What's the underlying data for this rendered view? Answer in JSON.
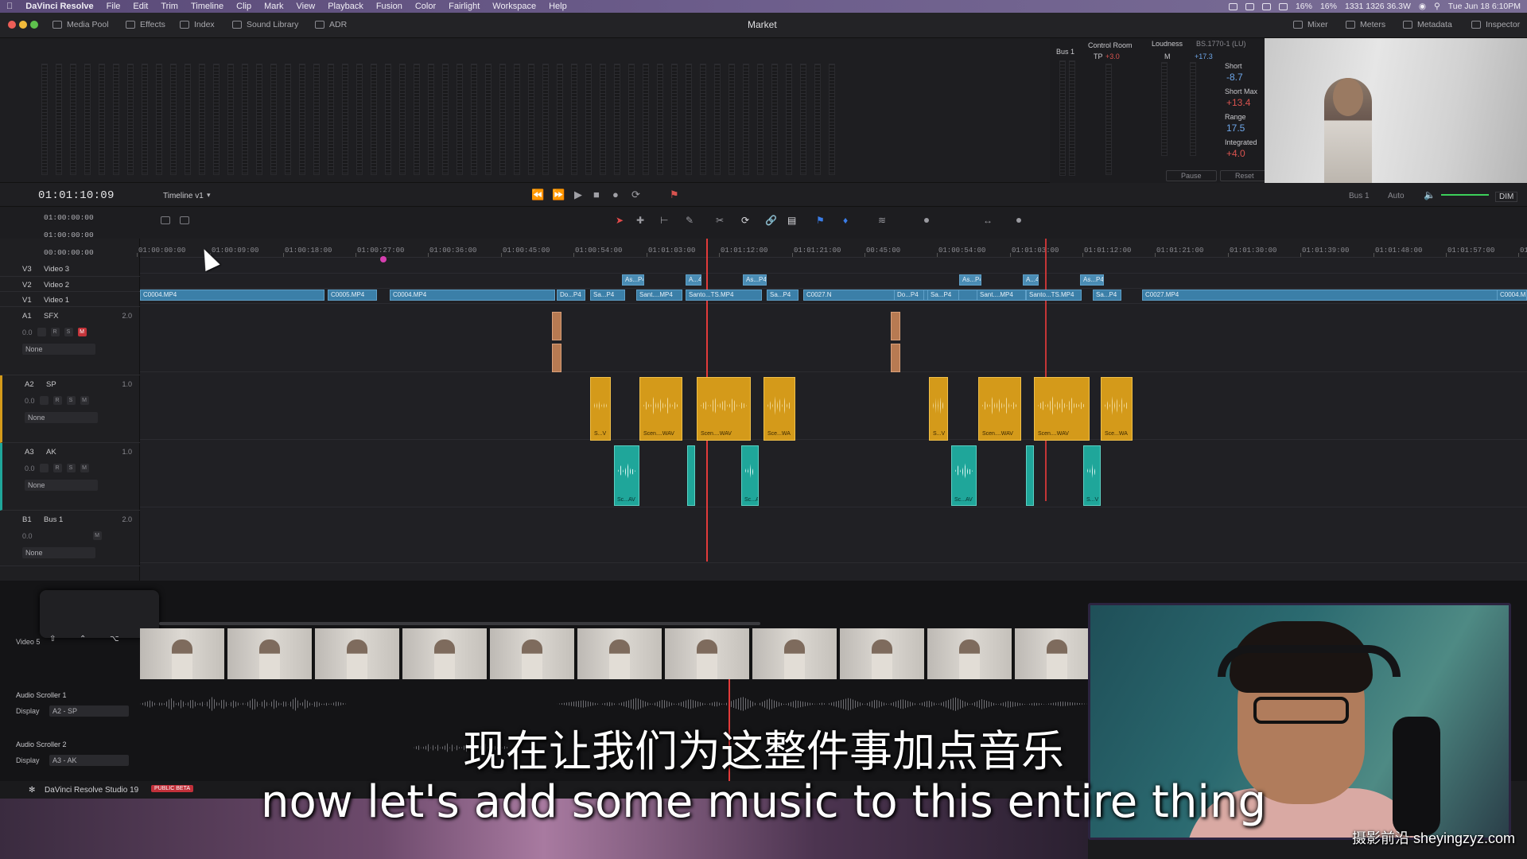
{
  "menubar": {
    "app": "DaVinci Resolve",
    "items": [
      "File",
      "Edit",
      "Trim",
      "Timeline",
      "Clip",
      "Mark",
      "View",
      "Playback",
      "Fusion",
      "Color",
      "Fairlight",
      "Workspace",
      "Help"
    ],
    "status": {
      "cpu1": "16%",
      "cpu2": "16%",
      "net": "1331 1326 36.3W",
      "datetime": "Tue Jun 18 6:10PM"
    }
  },
  "toolbar": {
    "media_pool": "Media Pool",
    "effects": "Effects",
    "index": "Index",
    "sound_library": "Sound Library",
    "adr": "ADR",
    "title": "Market",
    "mixer": "Mixer",
    "meters": "Meters",
    "metadata": "Metadata",
    "inspector": "Inspector"
  },
  "monitor": {
    "bus": "Bus 1",
    "control_room": "Control Room",
    "tp_label": "TP",
    "tp_value": "+3.0",
    "loudness": "Loudness",
    "standard": "BS.1770-1 (LU)",
    "m_label": "M",
    "m_value": "+17.3",
    "short_label": "Short",
    "short_value": "-8.7",
    "short_max_label": "Short Max",
    "short_max_value": "+13.4",
    "range_label": "Range",
    "range_value": "17.5",
    "integrated_label": "Integrated",
    "integrated_value": "+4.0",
    "pause": "Pause",
    "reset": "Reset"
  },
  "transport": {
    "timecode": "01:01:10:09",
    "timeline": "Timeline v1",
    "bus": "Bus 1",
    "auto": "Auto",
    "dim": "DIM"
  },
  "timecodes": {
    "in": "01:00:00:00",
    "out": "01:00:00:00",
    "duration": "00:00:00:00"
  },
  "ruler": [
    "01:00:00:00",
    "01:00:09:00",
    "01:00:18:00",
    "01:00:27:00",
    "01:00:36:00",
    "01:00:45:00",
    "01:00:54:00",
    "01:01:03:00",
    "01:01:12:00",
    "01:01:21:00",
    "00:45:00",
    "01:00:54:00",
    "01:01:03:00",
    "01:01:12:00",
    "01:01:21:00",
    "01:01:30:00",
    "01:01:39:00",
    "01:01:48:00",
    "01:01:57:00",
    "01:02:06:0"
  ],
  "tracks": {
    "v3": {
      "id": "V3",
      "name": "Video 3"
    },
    "v2": {
      "id": "V2",
      "name": "Video 2"
    },
    "v1": {
      "id": "V1",
      "name": "Video 1"
    },
    "a1": {
      "id": "A1",
      "name": "SFX",
      "vol": "2.0",
      "level": "0.0",
      "input": "None"
    },
    "a2": {
      "id": "A2",
      "name": "SP",
      "vol": "1.0",
      "level": "0.0",
      "input": "None"
    },
    "a3": {
      "id": "A3",
      "name": "AK",
      "vol": "1.0",
      "level": "0.0",
      "input": "None"
    },
    "b1": {
      "id": "B1",
      "name": "Bus 1",
      "vol": "2.0",
      "level": "0.0",
      "input": "None"
    }
  },
  "v1_clips": [
    "C0004.MP4",
    "C0005.MP4",
    "C0004.MP4",
    "Do...P4",
    "Sa...P4",
    "Sant....MP4",
    "Santo...TS.MP4",
    "Sa...P4",
    "C0027.N",
    "Do...P4",
    "Sa...P4",
    "Sant....MP4",
    "Santo...TS.MP4",
    "Sa...P4",
    "C0027.MP4",
    "C0004.M"
  ],
  "v2_clips": [
    "As...P4",
    "A...4",
    "As...P4",
    "As...P4",
    "A...4",
    "As...P4"
  ],
  "a2_clips": [
    "S...V",
    "Scen....WAV",
    "Scen....WAV",
    "Sce...WA",
    "S...V",
    "Scen....WAV",
    "Scen....WAV",
    "Sce...WA"
  ],
  "a3_clips": [
    "Sc...AV",
    "S...V",
    "Sc...AV",
    "S...V"
  ],
  "scroller": {
    "video": "Video 5",
    "audio1": "Audio Scroller 1",
    "audio2": "Audio Scroller 2",
    "display": "Display",
    "display1": "A2 - SP",
    "display2": "A3 - AK"
  },
  "footer": {
    "app": "DaVinci Resolve Studio 19",
    "badge": "PUBLIC BETA"
  },
  "subtitles": {
    "cn": "现在让我们为这整件事加点音乐",
    "en": "now let's add some music to this entire thing"
  },
  "watermark": "摄影前沿 sheyingzyz.com",
  "colors": {
    "video_clip": "#3b7fa8",
    "sp_clip": "#d49a1a",
    "ak_clip": "#1fa69a",
    "playhead": "#e23a3a",
    "accent": "#c3343a"
  }
}
